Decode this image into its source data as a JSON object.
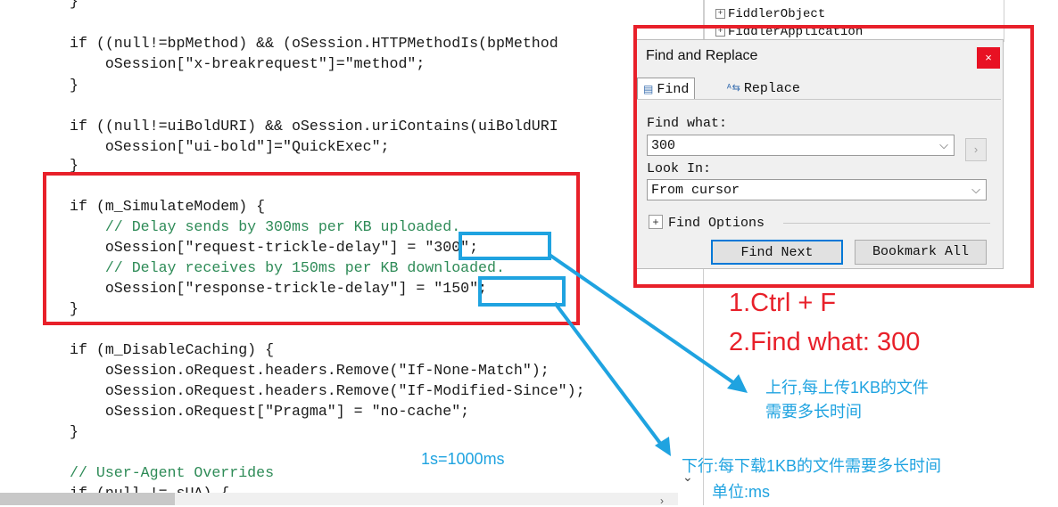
{
  "editor": {
    "lines": [
      {
        "t": "}"
      },
      {
        "t": "if ((null!=bpMethod) && (oSession.HTTPMethodIs(bpMethod"
      },
      {
        "t": "    oSession[\"x-breakrequest\"]=\"method\";"
      },
      {
        "t": "}"
      },
      {
        "t": "if ((null!=uiBoldURI) && oSession.uriContains(uiBoldURI"
      },
      {
        "t": "    oSession[\"ui-bold\"]=\"QuickExec\";"
      },
      {
        "t": "}"
      },
      {
        "t": "if (m_SimulateModem) {"
      },
      {
        "t": "    // Delay sends by 300ms per KB uploaded."
      },
      {
        "t": "    oSession[\"request-trickle-delay\"] = \"300\";"
      },
      {
        "t": "    // Delay receives by 150ms per KB downloaded."
      },
      {
        "t": "    oSession[\"response-trickle-delay\"] = \"150\";"
      },
      {
        "t": "}"
      },
      {
        "t": "if (m_DisableCaching) {"
      },
      {
        "t": "    oSession.oRequest.headers.Remove(\"If-None-Match\");"
      },
      {
        "t": "    oSession.oRequest.headers.Remove(\"If-Modified-Since\");"
      },
      {
        "t": "    oSession.oRequest[\"Pragma\"] = \"no-cache\";"
      },
      {
        "t": "}"
      },
      {
        "t": "// User-Agent Overrides"
      },
      {
        "t": "if (null != sUA) {"
      }
    ]
  },
  "tree": {
    "items": [
      "FiddlerObject",
      "FiddlerApplication"
    ]
  },
  "dialog": {
    "title": "Find and Replace",
    "close_icon": "×",
    "tab_find": "Find",
    "tab_replace": "Replace",
    "find_what_label": "Find what:",
    "find_what_value": "300",
    "look_in_label": "Look In:",
    "look_in_value": "From cursor",
    "find_options_label": "Find Options",
    "find_next_button": "Find Next",
    "bookmark_all_button": "Bookmark All"
  },
  "annotations": {
    "step1": "1.Ctrl + F",
    "step2": "2.Find what: 300",
    "upload_note_1": "上行,每上传1KB的文件",
    "upload_note_2": "需要多长时间",
    "download_note": "下行:每下载1KB的文件需要多长时间",
    "unit_note": "单位:ms",
    "conversion_note": "1s=1000ms"
  },
  "colors": {
    "annotation_red": "#e8202a",
    "annotation_blue": "#1fa3e0",
    "keyword": "#1a1a9c",
    "string": "#8b1a1a",
    "comment": "#2e8b57"
  }
}
